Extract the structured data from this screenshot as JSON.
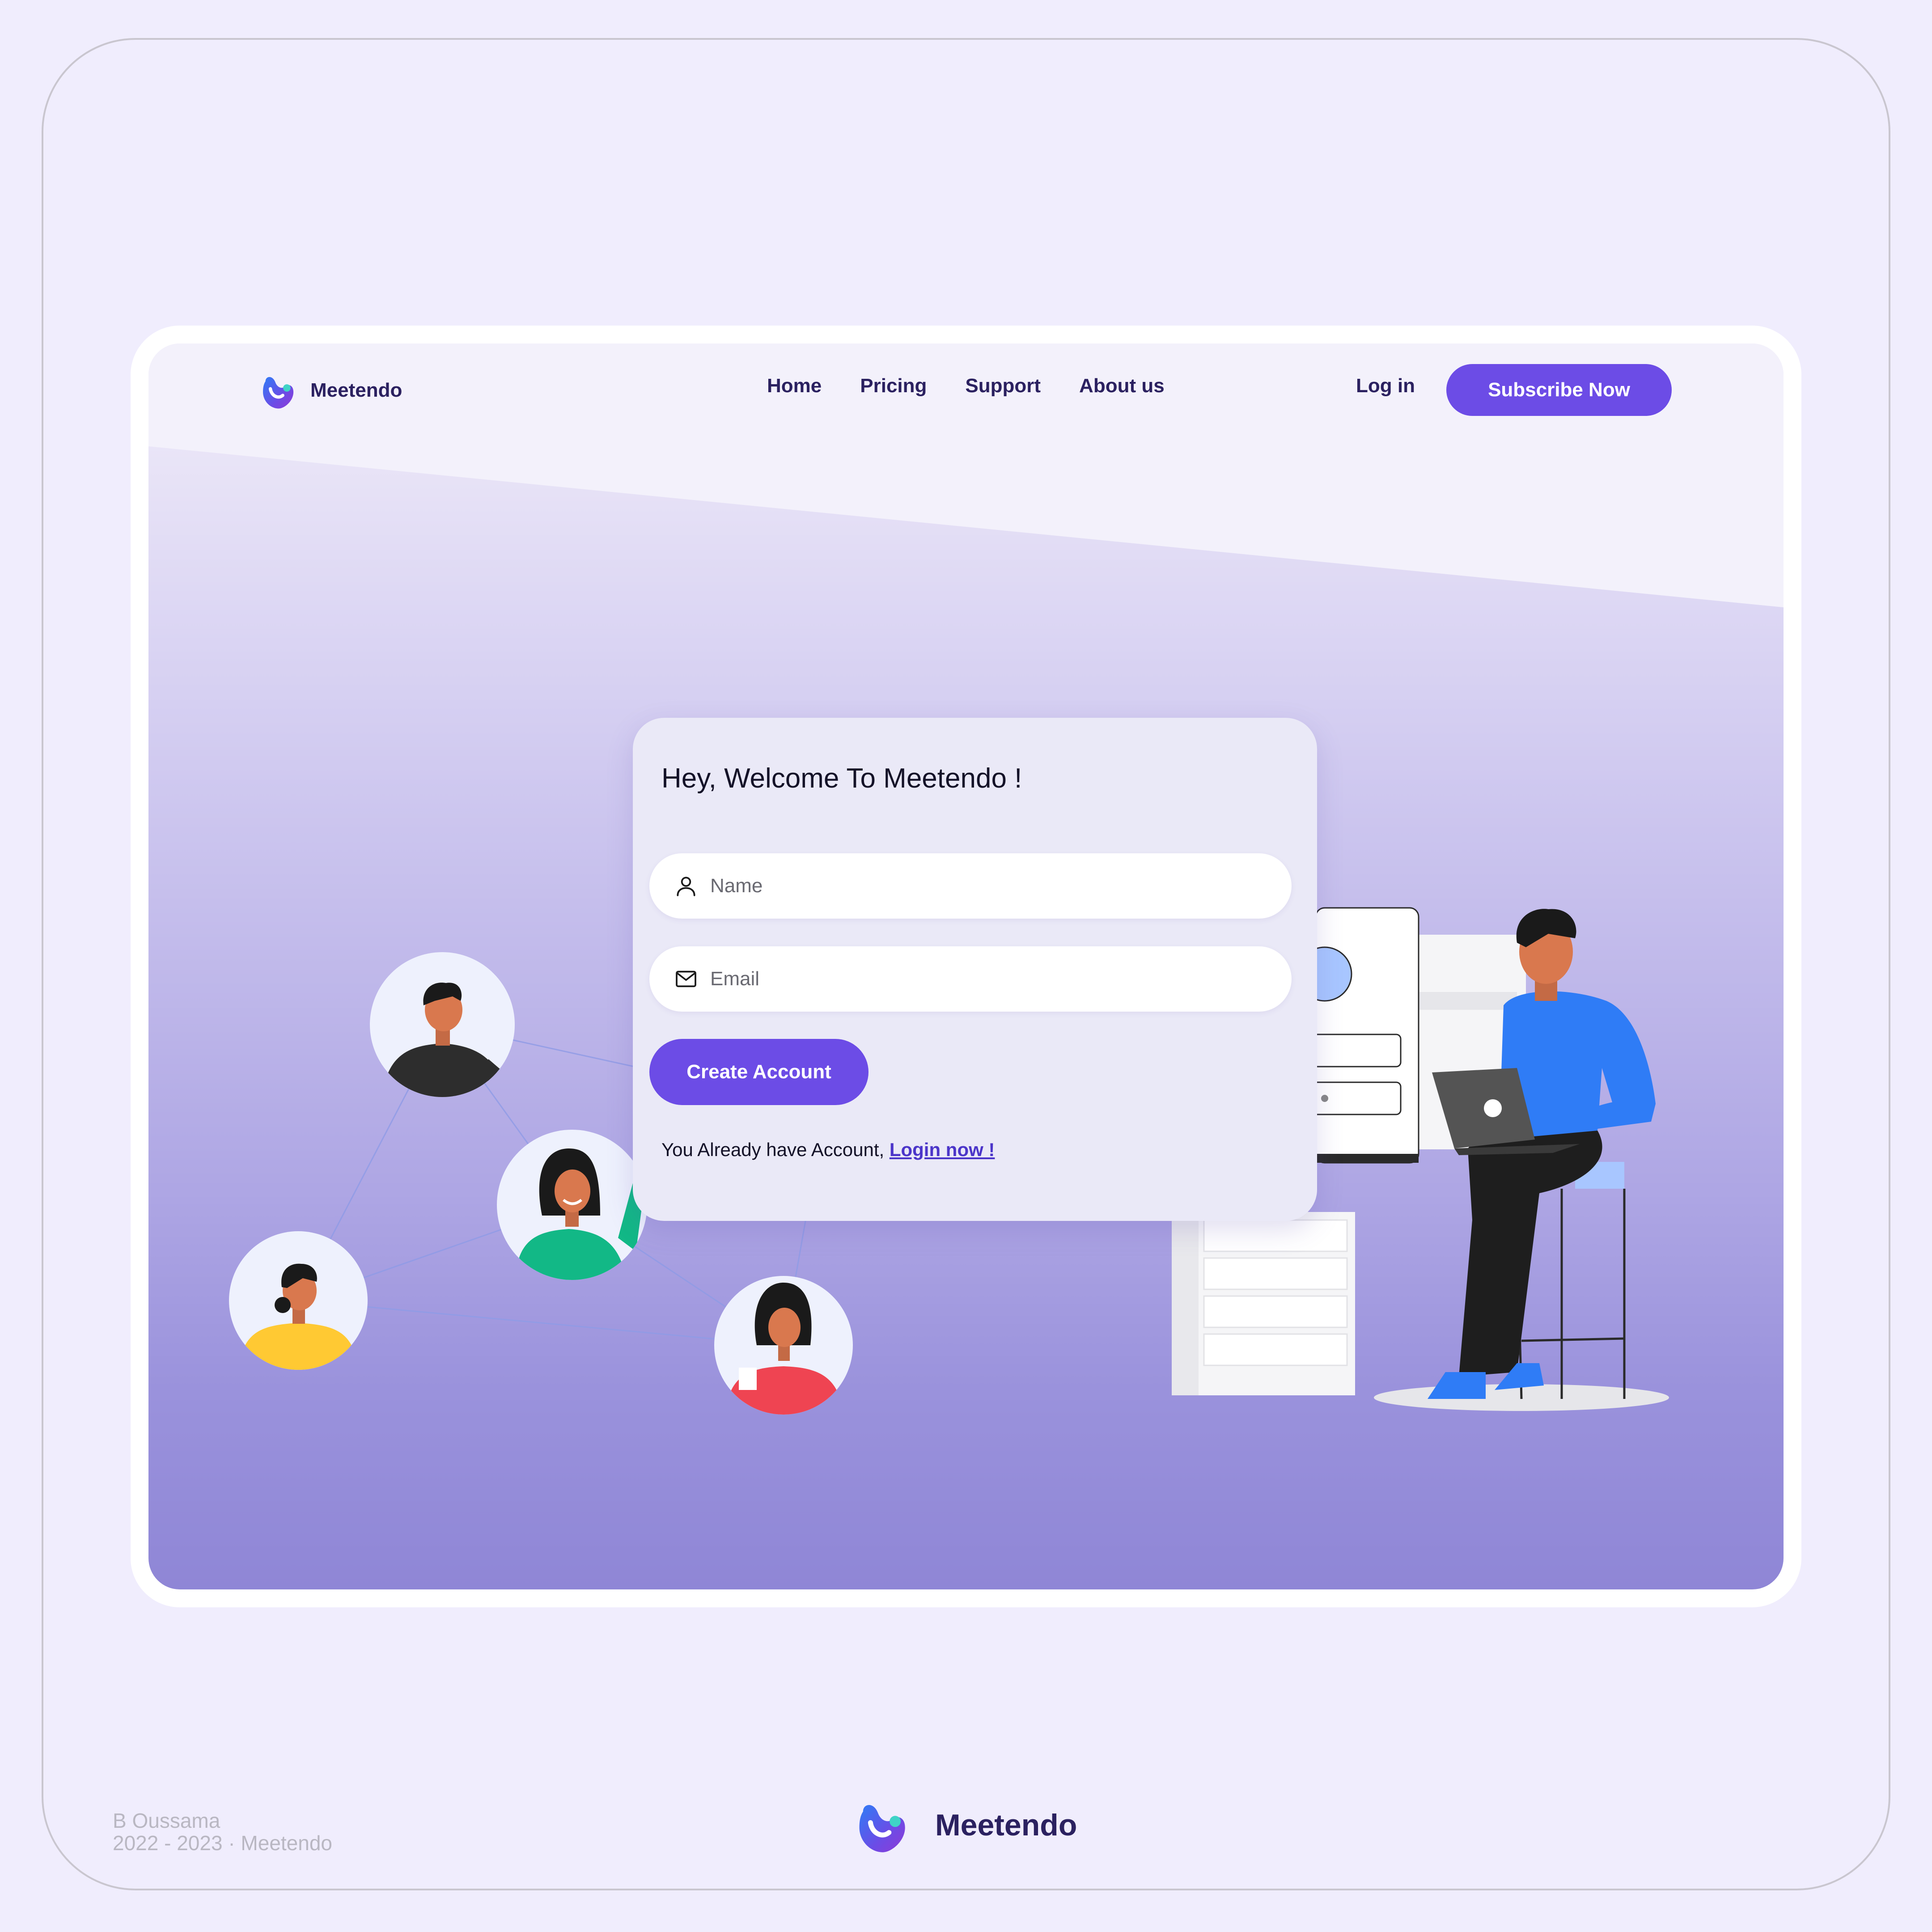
{
  "brand": {
    "name": "Meetendo",
    "logo_icon": "meetendo-logo-icon"
  },
  "nav": {
    "links": [
      "Home",
      "Pricing",
      "Support",
      "About us"
    ],
    "login": "Log in",
    "subscribe": "Subscribe Now"
  },
  "card": {
    "title": "Hey, Welcome To Meetendo !",
    "name_placeholder": "Name",
    "email_placeholder": "Email",
    "name_icon": "user-icon",
    "email_icon": "mail-icon",
    "create_button": "Create Account",
    "already_text": "You Already have Account, ",
    "login_link": "Login now !"
  },
  "footer": {
    "credit_line1": "B Oussama",
    "credit_line2": "2022 - 2023 · Meetendo",
    "brand_name": "Meetendo"
  },
  "colors": {
    "accent": "#6c4ce6",
    "text_dark": "#2b2160",
    "page_bg": "#f0edfd"
  }
}
